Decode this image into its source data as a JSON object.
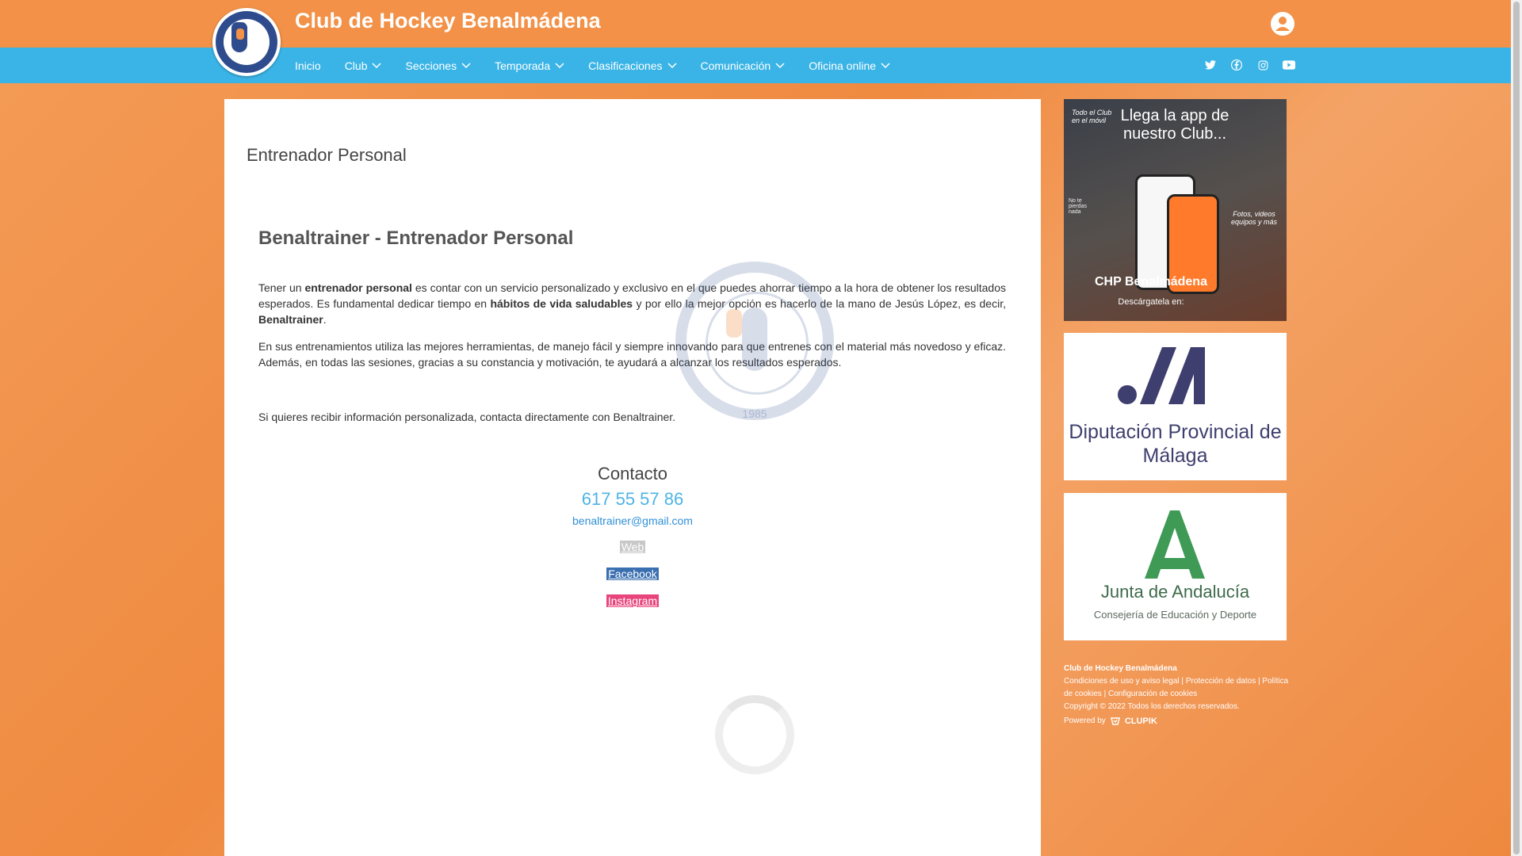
{
  "site": {
    "title": "Club de Hockey Benalmádena"
  },
  "nav": {
    "items": [
      {
        "label": "Inicio",
        "has_dropdown": false
      },
      {
        "label": "Club",
        "has_dropdown": true
      },
      {
        "label": "Secciones",
        "has_dropdown": true
      },
      {
        "label": "Temporada",
        "has_dropdown": true
      },
      {
        "label": "Clasificaciones",
        "has_dropdown": true
      },
      {
        "label": "Comunicación",
        "has_dropdown": true
      },
      {
        "label": "Oficina online",
        "has_dropdown": true
      }
    ],
    "socials": [
      "twitter-icon",
      "facebook-icon",
      "instagram-icon",
      "youtube-icon"
    ]
  },
  "page": {
    "title": "Entrenador Personal",
    "article_title": "Benaltrainer - Entrenador Personal",
    "p1_a": "Tener un ",
    "p1_b": "entrenador personal",
    "p1_c": " es contar con un servicio personalizado y exclusivo en el que puedes ahorrar tiempo a la hora de obtener los resultados esperados. Es fundamental dedicar tiempo en ",
    "p1_d": "hábitos de vida saludables",
    "p1_e": " y por ello la mejor opción es hacerlo de la mano de Jesús López, es decir, ",
    "p1_f": "Benaltrainer",
    "p1_g": ".",
    "p2": "En sus entrenamientos utiliza las mejores herramientas, de manejo fácil y siempre innovando para que entrenes con el material más novedoso y eficaz. Además, en todas las sesiones, gracias a su constancia y motivación, te ayudará a alcanzar los resultados esperados.",
    "p3": "Si quieres recibir información personalizada, contacta directamente con Benaltrainer.",
    "contact_title": "Contacto",
    "phone": "617 55 57 86",
    "email": "benaltrainer@gmail.com",
    "btn_web": "Web",
    "btn_facebook": "Facebook",
    "btn_instagram": "Instagram",
    "watermark_year": "1985"
  },
  "sidebar": {
    "ad1": {
      "small": "Todo el Club en el móvil",
      "headline": "Llega la app de nuestro Club...",
      "side_list": "No te pierdas nada",
      "side_right": "Fotos, videos equipos y más",
      "brand": "CHP Benalmádena",
      "download": "Descárgatela en:"
    },
    "ad2": {
      "text": "Diputación Provincial de Málaga"
    },
    "ad3": {
      "text": "Junta de Andalucía",
      "sub": "Consejería de Educación y Deporte"
    }
  },
  "footer": {
    "name": "Club de Hockey Benalmádena",
    "link1": "Condiciones de uso y aviso legal",
    "link2": "Protección de datos",
    "link3": "Política de cookies",
    "link4": "Configuración de cookies",
    "copyright": "Copyright © 2022 Todos los derechos reservados.",
    "powered": "Powered by",
    "brand": "CLUPIK"
  },
  "colors": {
    "header": "#f29147",
    "nav": "#3ab4e6",
    "link": "#2f8fd6",
    "phone": "#4db3e6"
  }
}
